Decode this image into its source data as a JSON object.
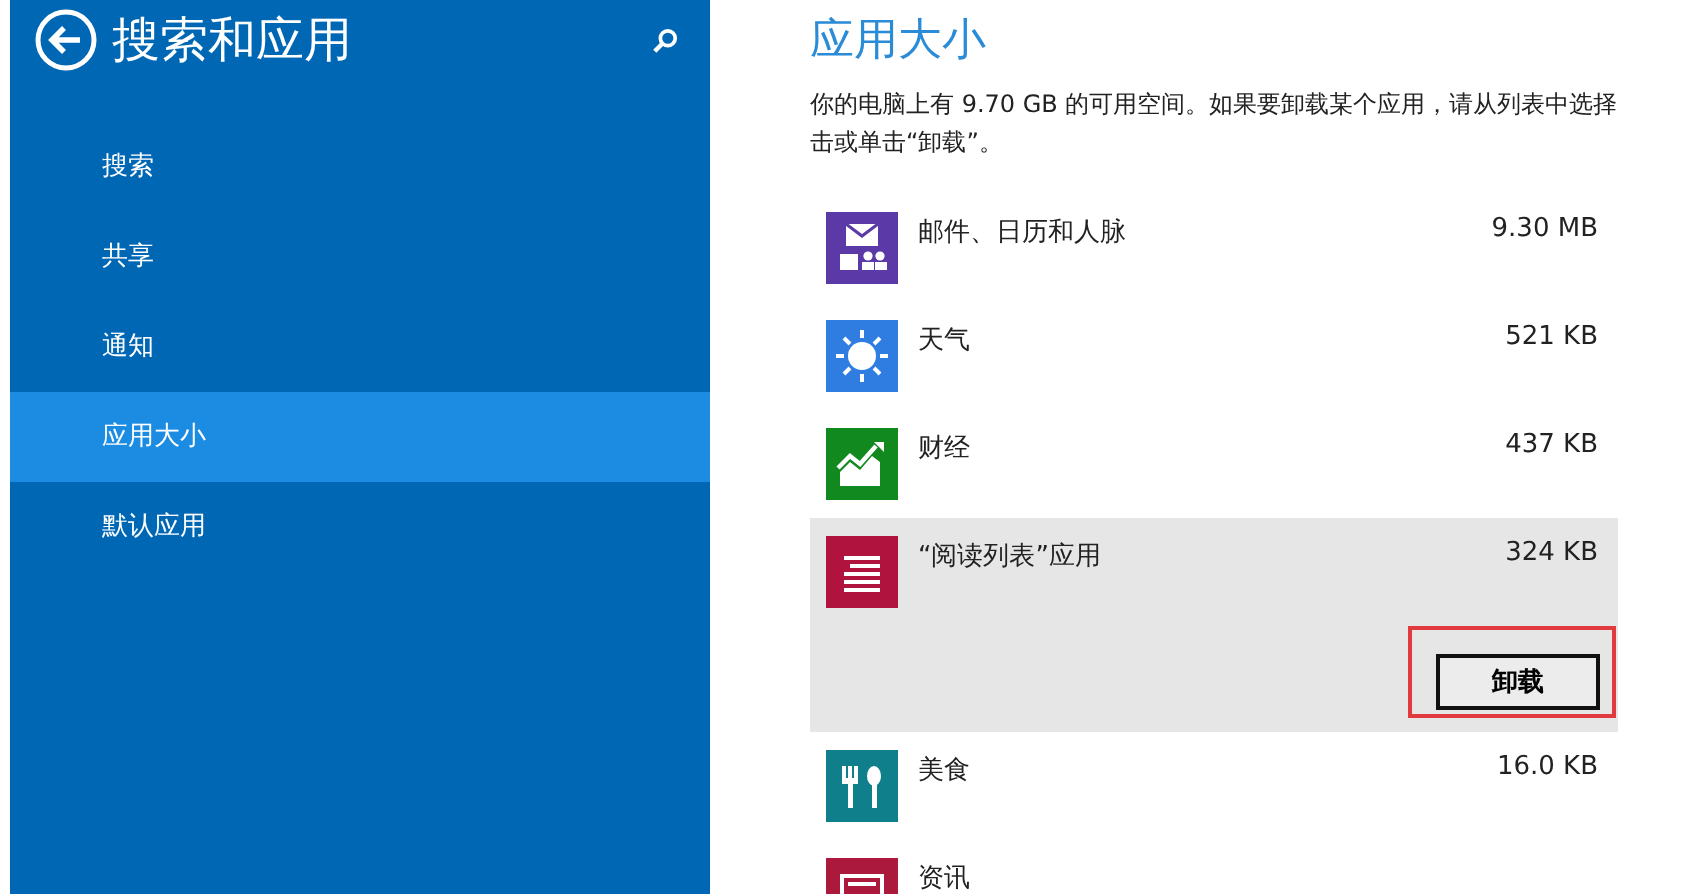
{
  "sidebar": {
    "title": "搜索和应用",
    "items": [
      {
        "label": "搜索",
        "selected": false
      },
      {
        "label": "共享",
        "selected": false
      },
      {
        "label": "通知",
        "selected": false
      },
      {
        "label": "应用大小",
        "selected": true
      },
      {
        "label": "默认应用",
        "selected": false
      }
    ]
  },
  "content": {
    "title": "应用大小",
    "description_lines": [
      "你的电脑上有 9.70 GB 的可用空间。如果要卸载某个应用，请从列表中选择",
      "击或单击“卸载”。"
    ],
    "apps": [
      {
        "name": "邮件、日历和人脉",
        "size": "9.30 MB",
        "kind": "mail",
        "color": "#5b3aa8",
        "selected": false
      },
      {
        "name": "天气",
        "size": "521 KB",
        "kind": "weather",
        "color": "#2f7de1",
        "selected": false
      },
      {
        "name": "财经",
        "size": "437 KB",
        "kind": "finance",
        "color": "#12891f",
        "selected": false
      },
      {
        "name": "“阅读列表”应用",
        "size": "324 KB",
        "kind": "reading",
        "color": "#b0143e",
        "selected": true,
        "button": {
          "label": "卸载",
          "highlighted": true
        }
      },
      {
        "name": "美食",
        "size": "16.0 KB",
        "kind": "food",
        "color": "#0f7f8c",
        "selected": false
      },
      {
        "name": "资讯",
        "kind": "news",
        "color": "#ab1a3c",
        "selected": false
      }
    ]
  }
}
